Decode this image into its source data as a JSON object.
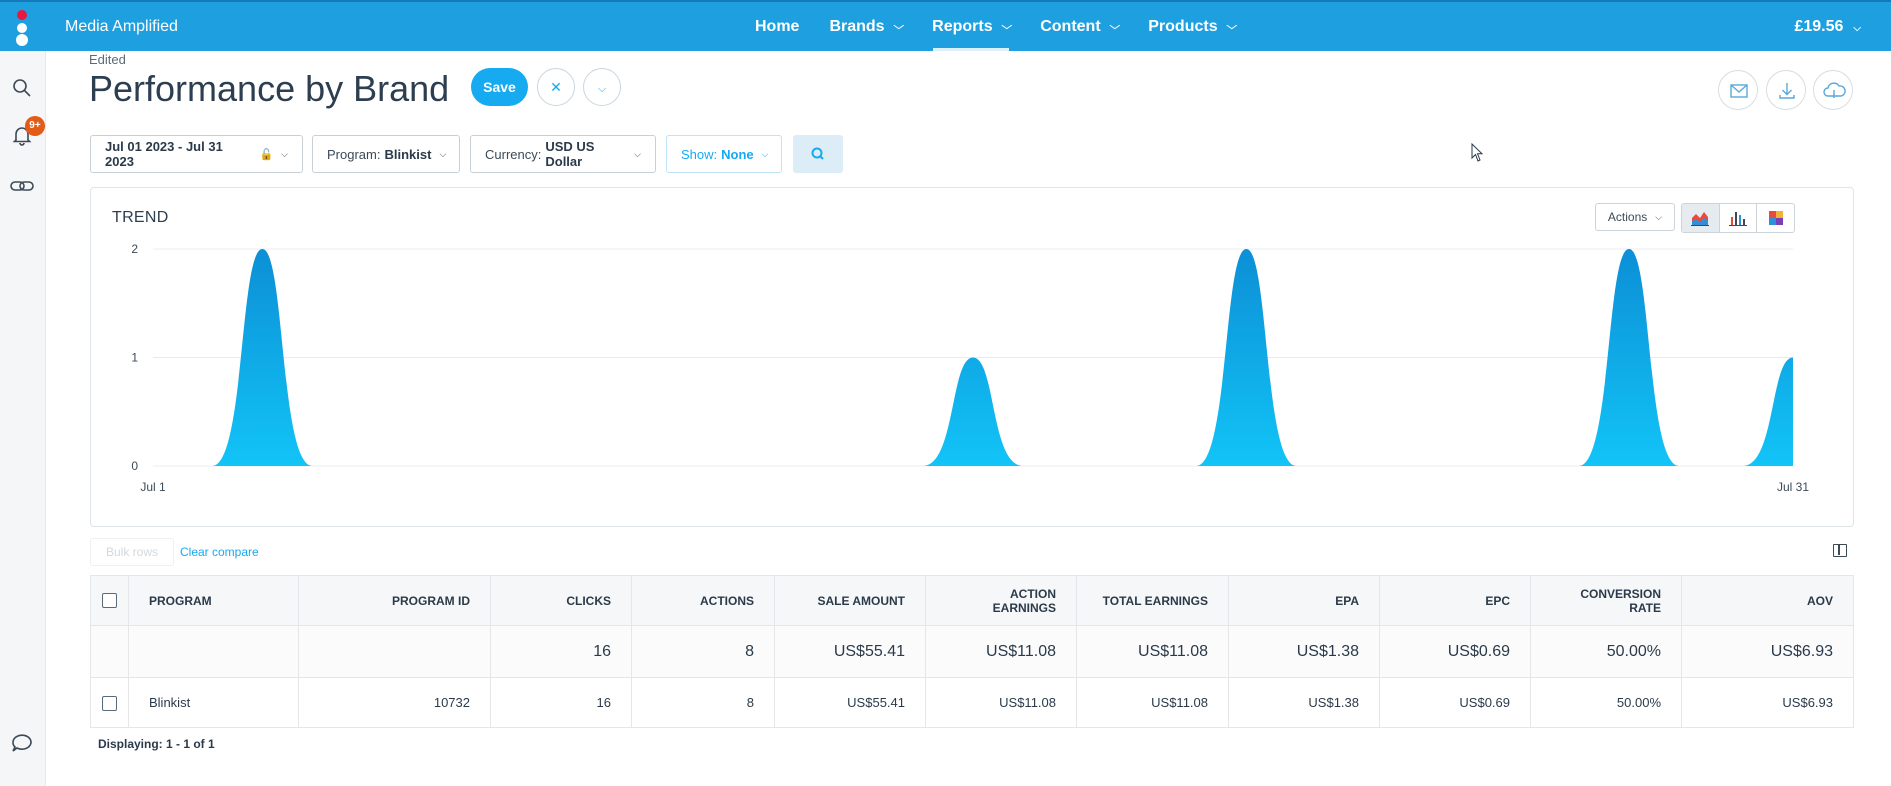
{
  "app": {
    "brand_name": "Media Amplified",
    "balance": "£19.56"
  },
  "nav": [
    {
      "label": "Home",
      "dropdown": false,
      "active": false
    },
    {
      "label": "Brands",
      "dropdown": true,
      "active": false
    },
    {
      "label": "Reports",
      "dropdown": true,
      "active": true
    },
    {
      "label": "Content",
      "dropdown": true,
      "active": false
    },
    {
      "label": "Products",
      "dropdown": true,
      "active": false
    }
  ],
  "sidebar": {
    "notification_badge": "9+"
  },
  "header": {
    "status": "Edited",
    "title": "Performance by Brand",
    "save_label": "Save"
  },
  "filters": {
    "date_range": "Jul 01 2023 - Jul 31 2023",
    "program_label": "Program:",
    "program_value": "Blinkist",
    "currency_label": "Currency:",
    "currency_value": "USD US Dollar",
    "show_label": "Show:",
    "show_value": "None"
  },
  "trend": {
    "title": "TREND",
    "actions_label": "Actions"
  },
  "chart_data": {
    "type": "area",
    "x_start_label": "Jul 1",
    "x_end_label": "Jul 31",
    "x": [
      1,
      2,
      3,
      4,
      5,
      6,
      7,
      8,
      9,
      10,
      11,
      12,
      13,
      14,
      15,
      16,
      17,
      18,
      19,
      20,
      21,
      22,
      23,
      24,
      25,
      26,
      27,
      28,
      29,
      30,
      31
    ],
    "values": [
      0,
      0,
      2,
      0,
      0,
      0,
      0,
      0,
      0,
      0,
      0,
      0,
      0,
      0,
      0,
      1,
      0,
      0,
      0,
      0,
      2,
      0,
      0,
      0,
      0,
      0,
      0,
      2,
      0,
      0,
      1
    ],
    "y_ticks": [
      0,
      1,
      2
    ],
    "ylim": [
      0,
      2
    ],
    "grid": true,
    "color": "#16b4f0"
  },
  "table": {
    "bulk_label": "Bulk rows",
    "clear_compare": "Clear compare",
    "columns": [
      "PROGRAM",
      "PROGRAM ID",
      "CLICKS",
      "ACTIONS",
      "SALE AMOUNT",
      "ACTION EARNINGS",
      "TOTAL EARNINGS",
      "EPA",
      "EPC",
      "CONVERSION RATE",
      "AOV"
    ],
    "totals": {
      "clicks": "16",
      "actions": "8",
      "sale_amount": "US$55.41",
      "action_earnings": "US$11.08",
      "total_earnings": "US$11.08",
      "epa": "US$1.38",
      "epc": "US$0.69",
      "conversion_rate": "50.00%",
      "aov": "US$6.93"
    },
    "rows": [
      {
        "program": "Blinkist",
        "program_id": "10732",
        "clicks": "16",
        "actions": "8",
        "sale_amount": "US$55.41",
        "action_earnings": "US$11.08",
        "total_earnings": "US$11.08",
        "epa": "US$1.38",
        "epc": "US$0.69",
        "conversion_rate": "50.00%",
        "aov": "US$6.93"
      }
    ],
    "displaying": "Displaying: 1 - 1 of 1"
  }
}
